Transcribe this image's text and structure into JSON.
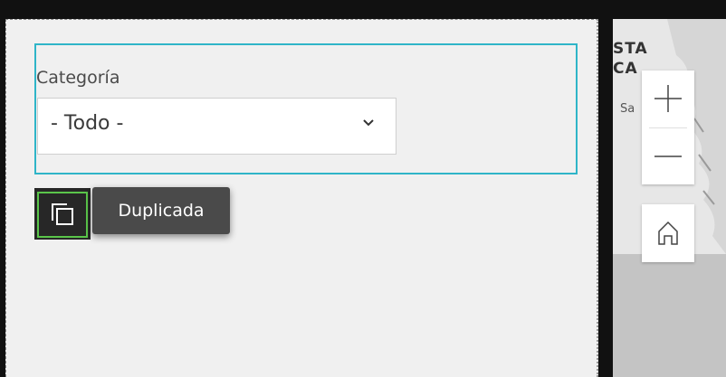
{
  "filter": {
    "category_label": "Categoría",
    "category_value": "- Todo -"
  },
  "duplicate": {
    "tooltip": "Duplicada",
    "icon": "copy-icon"
  },
  "map": {
    "labels": [
      "STA",
      "CA"
    ],
    "small_label": "Sa",
    "controls": [
      "zoom-in-icon",
      "zoom-out-icon",
      "home-icon"
    ]
  },
  "colors": {
    "filter_border": "#2fb5c8",
    "focus_ring": "#5ac54a",
    "tooltip_bg": "#4a4a4a"
  }
}
